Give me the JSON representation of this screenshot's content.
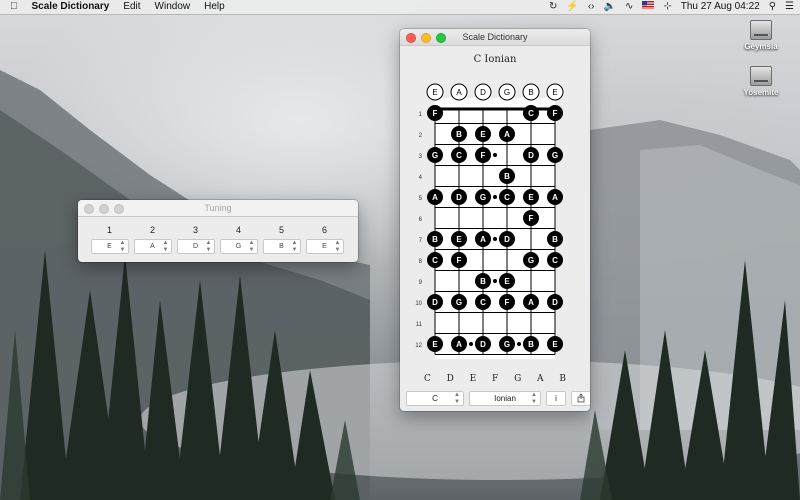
{
  "menubar": {
    "apple_icon": "apple-logo-icon",
    "app_name": "Scale Dictionary",
    "menus": [
      "Edit",
      "Window",
      "Help"
    ],
    "clock": "Thu 27 Aug  04:22",
    "status_icons": [
      "sync-icon",
      "bolt-icon",
      "code-icon",
      "volume-icon",
      "activity-icon",
      "flag-us-icon",
      "wifi-icon",
      "search-icon",
      "list-icon"
    ]
  },
  "desktop": {
    "icons": [
      {
        "label": "Geymsla"
      },
      {
        "label": "Yosemite"
      }
    ]
  },
  "tuning_window": {
    "title": "Tuning",
    "columns": [
      {
        "number": "1",
        "note": "E"
      },
      {
        "number": "2",
        "note": "A"
      },
      {
        "number": "3",
        "note": "D"
      },
      {
        "number": "4",
        "note": "G"
      },
      {
        "number": "5",
        "note": "B"
      },
      {
        "number": "6",
        "note": "E"
      }
    ]
  },
  "scale_window": {
    "title": "Scale Dictionary",
    "scale_title": "C Ionian",
    "open_strings": [
      "E",
      "A",
      "D",
      "G",
      "B",
      "E"
    ],
    "fret_numbers": [
      "1",
      "2",
      "3",
      "4",
      "5",
      "6",
      "7",
      "8",
      "9",
      "10",
      "11",
      "12"
    ],
    "fret_notes": [
      [
        "F",
        "",
        "",
        "",
        "C",
        "F"
      ],
      [
        "",
        "B",
        "E",
        "A",
        "",
        ""
      ],
      [
        "G",
        "C",
        "F",
        "",
        "D",
        "G"
      ],
      [
        "",
        "",
        "",
        "B",
        "",
        ""
      ],
      [
        "A",
        "D",
        "G",
        "C",
        "E",
        "A"
      ],
      [
        "",
        "",
        "",
        "",
        "F",
        ""
      ],
      [
        "B",
        "E",
        "A",
        "D",
        "",
        "B"
      ],
      [
        "C",
        "F",
        "",
        "",
        "G",
        "C"
      ],
      [
        "",
        "",
        "B",
        "E",
        "",
        ""
      ],
      [
        "D",
        "G",
        "C",
        "F",
        "A",
        "D"
      ],
      [
        "",
        "",
        "",
        "",
        "",
        ""
      ],
      [
        "E",
        "A",
        "D",
        "G",
        "B",
        "E"
      ]
    ],
    "scale_notes": [
      "C",
      "D",
      "E",
      "F",
      "G",
      "A",
      "B"
    ],
    "key_select": "C",
    "mode_select": "Ionian",
    "info_button": "i",
    "share_icon": "share-icon"
  }
}
